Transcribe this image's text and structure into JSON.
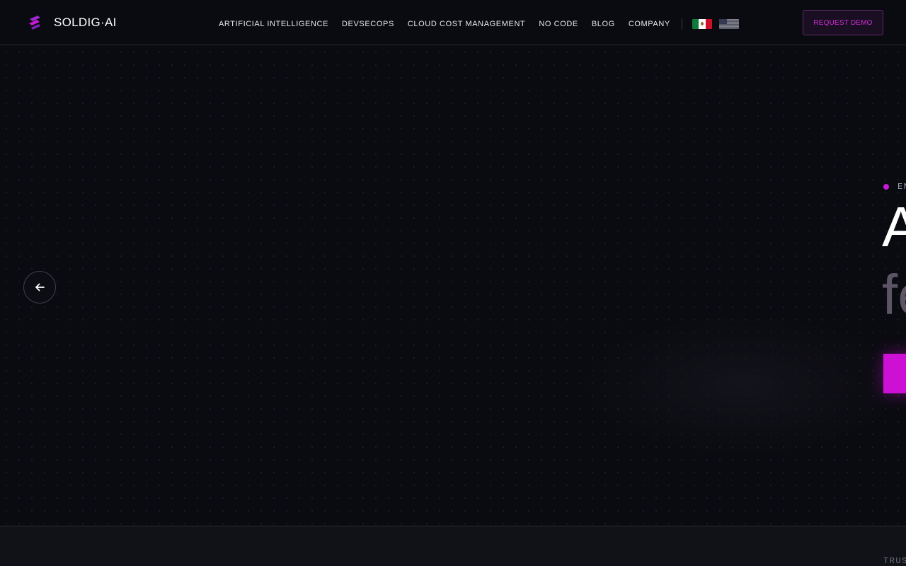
{
  "header": {
    "logo_text": "SOLDIG·AI",
    "nav": [
      {
        "label": "ARTIFICIAL INTELLIGENCE"
      },
      {
        "label": "DEVSECOPS"
      },
      {
        "label": "CLOUD COST MANAGEMENT"
      },
      {
        "label": "NO CODE"
      },
      {
        "label": "BLOG"
      },
      {
        "label": "COMPANY"
      }
    ],
    "languages": [
      "mexico-flag-icon",
      "us-flag-icon"
    ],
    "cta_label": "REQUEST DEMO"
  },
  "hero": {
    "prev_icon": "arrow-left-icon",
    "eyebrow": "EN",
    "headline_line1": "A",
    "headline_line2": "fe",
    "cta_label": ""
  },
  "trusted": {
    "label": "TRUS"
  },
  "colors": {
    "background": "#0a0b10",
    "accent": "#cc10d4",
    "muted_heading": "#5b5566",
    "border": "#2a2c33"
  }
}
